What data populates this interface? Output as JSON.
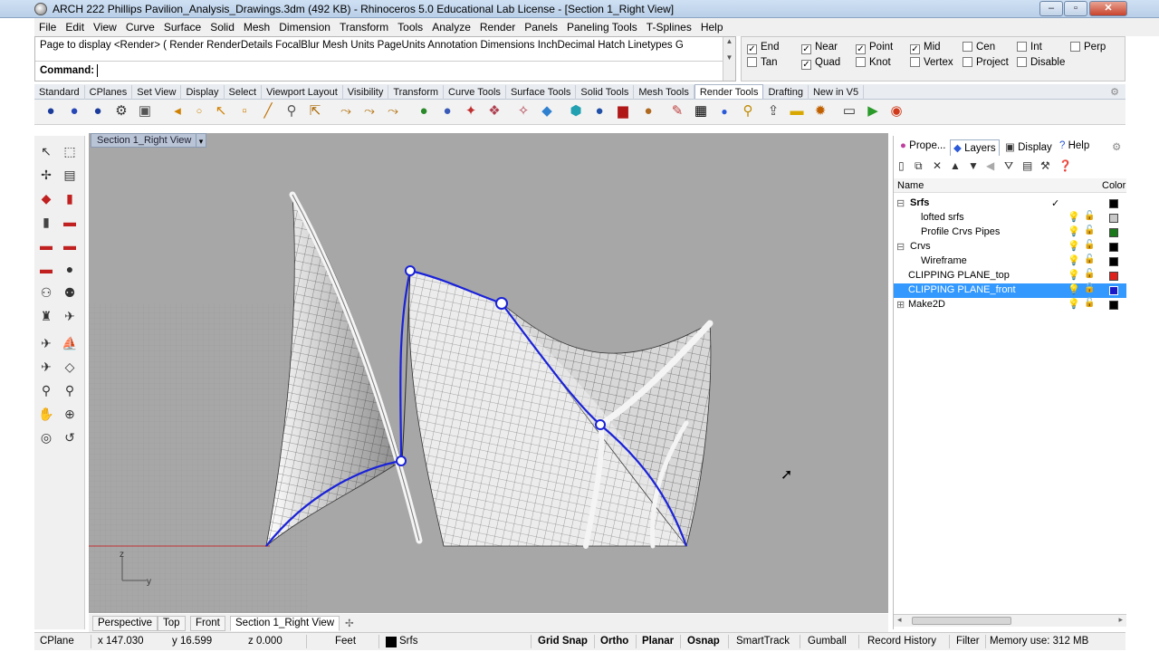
{
  "window": {
    "title": "ARCH 222 Phillips Pavilion_Analysis_Drawings.3dm (492 KB) - Rhinoceros 5.0 Educational Lab License - [Section 1_Right View]",
    "min": "–",
    "max": "▫",
    "close": "✕"
  },
  "menu": [
    "File",
    "Edit",
    "View",
    "Curve",
    "Surface",
    "Solid",
    "Mesh",
    "Dimension",
    "Transform",
    "Tools",
    "Analyze",
    "Render",
    "Panels",
    "Paneling Tools",
    "T-Splines",
    "Help"
  ],
  "command": {
    "history": "Page to display <Render> ( Render RenderDetails FocalBlur Mesh Units PageUnits Annotation Dimensions InchDecimal Hatch Linetypes G",
    "prompt": "Command:"
  },
  "osnaps": [
    {
      "label": "End",
      "checked": true
    },
    {
      "label": "Near",
      "checked": true
    },
    {
      "label": "Point",
      "checked": true
    },
    {
      "label": "Mid",
      "checked": true
    },
    {
      "label": "Cen",
      "checked": false
    },
    {
      "label": "Int",
      "checked": false
    },
    {
      "label": "Perp",
      "checked": false
    },
    {
      "label": "Tan",
      "checked": false
    },
    {
      "label": "Quad",
      "checked": true
    },
    {
      "label": "Knot",
      "checked": false
    },
    {
      "label": "Vertex",
      "checked": false
    },
    {
      "label": "Project",
      "checked": false
    },
    {
      "label": "Disable",
      "checked": false
    }
  ],
  "toolbar_tabs": [
    "Standard",
    "CPlanes",
    "Set View",
    "Display",
    "Select",
    "Viewport Layout",
    "Visibility",
    "Transform",
    "Curve Tools",
    "Surface Tools",
    "Solid Tools",
    "Mesh Tools",
    "Render Tools",
    "Drafting",
    "New in V5"
  ],
  "active_toolbar_tab": "Render Tools",
  "viewport": {
    "label": "Section 1_Right View",
    "axis_z": "z",
    "axis_y": "y"
  },
  "view_tabs": [
    "Perspective",
    "Top",
    "Front",
    "Section 1_Right View"
  ],
  "view_tab_add": "✢",
  "panel_tabs": [
    "Prope...",
    "Layers",
    "Display",
    "Help"
  ],
  "layers": {
    "header_name": "Name",
    "header_color": "Color",
    "rows": [
      {
        "name": "Srfs",
        "expander": "⊟",
        "current": "✓",
        "color": "#000000"
      },
      {
        "name": "lofted srfs",
        "expander": "",
        "current": "",
        "color": "#c8c8c8"
      },
      {
        "name": "Profile Crvs Pipes",
        "expander": "",
        "current": "",
        "color": "#1a7a1a"
      },
      {
        "name": "Crvs",
        "expander": "⊟",
        "current": "",
        "color": "#000000"
      },
      {
        "name": "Wireframe",
        "expander": "",
        "current": "",
        "color": "#000000"
      },
      {
        "name": "CLIPPING PLANE_top",
        "expander": "",
        "current": "",
        "color": "#e0201a"
      },
      {
        "name": "CLIPPING PLANE_front",
        "expander": "",
        "current": "",
        "color": "#1a1ac8"
      },
      {
        "name": "Make2D",
        "expander": "⊞",
        "current": "",
        "color": "#000000"
      }
    ]
  },
  "status": {
    "cplane": "CPlane",
    "x": "x 147.030",
    "y": "y 16.599",
    "z": "z 0.000",
    "units": "Feet",
    "layer": "Srfs",
    "grid_snap": "Grid Snap",
    "ortho": "Ortho",
    "planar": "Planar",
    "osnap": "Osnap",
    "smarttrack": "SmartTrack",
    "gumball": "Gumball",
    "record_history": "Record History",
    "filter": "Filter",
    "memory": "Memory use: 312 MB"
  },
  "colors": {
    "viewport_bg": "#a7a7a7",
    "selection": "#3399ff",
    "curve": "#1a22d8"
  }
}
